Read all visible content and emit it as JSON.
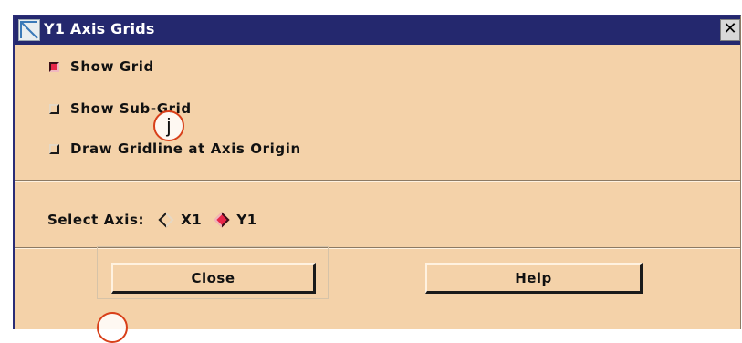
{
  "window": {
    "title": "Y1 Axis Grids",
    "close_glyph": "✕",
    "icon": "window-menu-icon"
  },
  "options": [
    {
      "label": "Show Grid",
      "checked": true
    },
    {
      "label": "Show Sub-Grid",
      "checked": false
    },
    {
      "label": "Draw Gridline at Axis Origin",
      "checked": false
    }
  ],
  "axis_select": {
    "label": "Select Axis:",
    "choices": [
      {
        "label": "X1",
        "selected": false
      },
      {
        "label": "Y1",
        "selected": true
      }
    ]
  },
  "buttons": {
    "close_label": "Close",
    "help_label": "Help"
  },
  "annotations": {
    "marker_1": "j",
    "marker_2": ""
  },
  "colors": {
    "titlebar": "#24286e",
    "dialog_bg": "#f4d2a9",
    "checked_accent": "#e8264a"
  }
}
